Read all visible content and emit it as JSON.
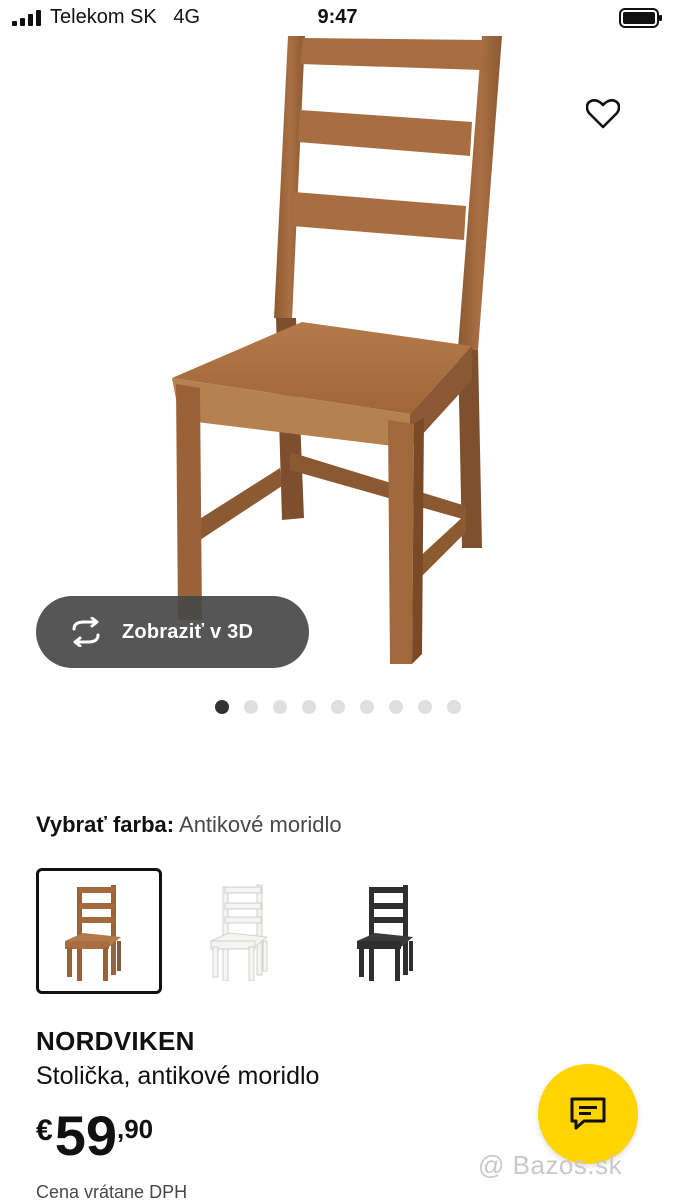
{
  "status_bar": {
    "carrier": "Telekom SK",
    "network": "4G",
    "time": "9:47"
  },
  "hero": {
    "view3d_label": "Zobraziť v 3D",
    "image_count": 9,
    "active_image": 1
  },
  "color": {
    "label": "Vybrať farba:",
    "value": "Antikové moridlo",
    "options": [
      {
        "color": "#a4683c",
        "selected": true
      },
      {
        "color": "#f2f2f0",
        "selected": false
      },
      {
        "color": "#2f2f2f",
        "selected": false
      }
    ]
  },
  "product": {
    "name": "NORDVIKEN",
    "description": "Stolička, antikové moridlo",
    "currency": "€",
    "price_whole": "59",
    "price_separator": ",",
    "price_decimal": "90",
    "tax_note": "Cena vrátane DPH"
  },
  "watermark": "@ Bazos.sk",
  "colors": {
    "accent": "#ffd400",
    "wood": "#a4683c",
    "pill": "#484848"
  }
}
